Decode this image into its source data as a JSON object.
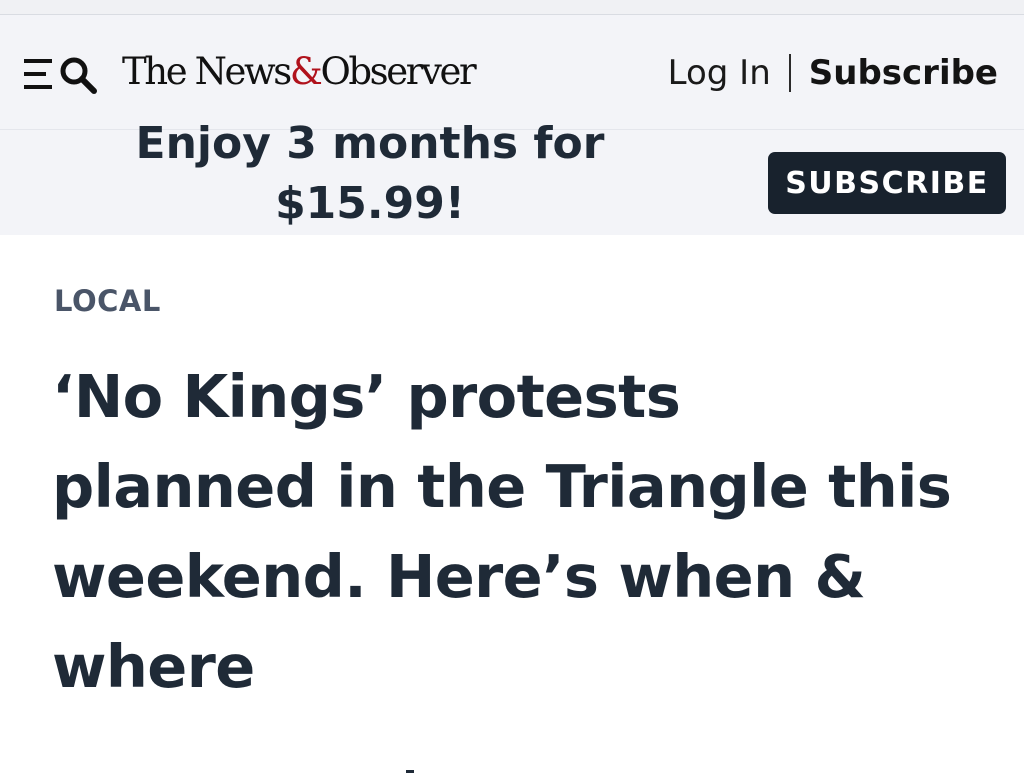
{
  "header": {
    "logo_prefix": "The News",
    "logo_amp": "&",
    "logo_suffix": "Observer",
    "login_label": "Log In",
    "subscribe_label": "Subscribe",
    "menu_icon": "menu-icon",
    "search_icon": "search-icon"
  },
  "promo": {
    "text": "Enjoy 3 months for $15.99!",
    "button_label": "SUBSCRIBE"
  },
  "article": {
    "section": "LOCAL",
    "headline": "‘No Kings’ protests planned in the Triangle this weekend. Here’s when & where"
  },
  "colors": {
    "header_bg": "#f3f4f8",
    "text_dark": "#1f2a37",
    "button_bg": "#18222d",
    "logo_amp": "#b0121c",
    "section_label": "#4a5568"
  }
}
